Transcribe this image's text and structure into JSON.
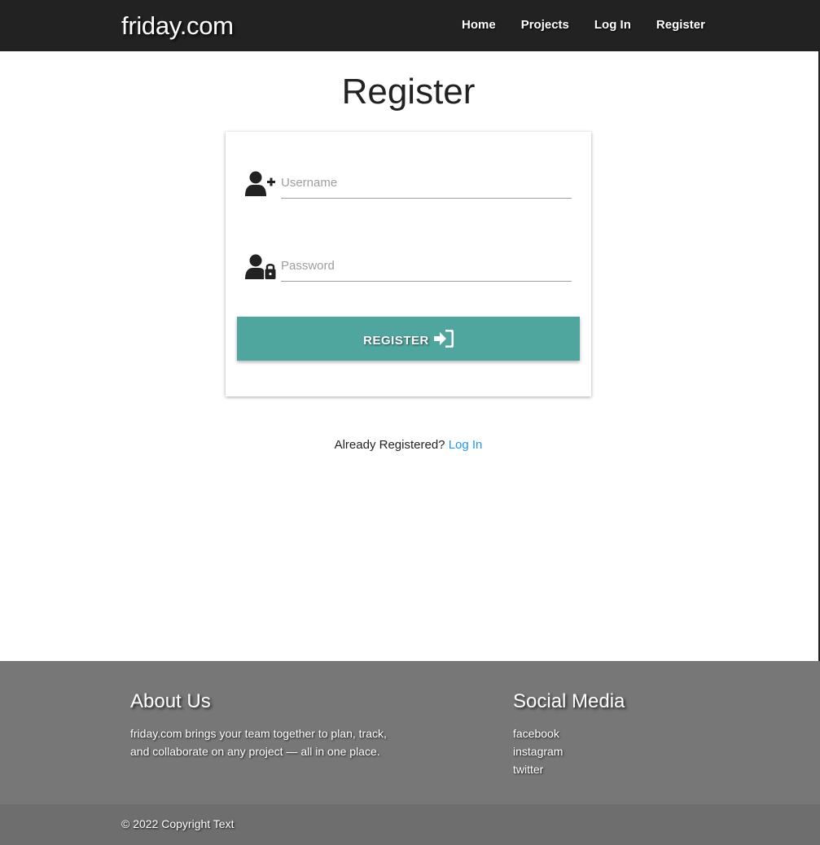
{
  "navbar": {
    "brand": "friday.com",
    "links": [
      {
        "label": "Home"
      },
      {
        "label": "Projects"
      },
      {
        "label": "Log In"
      },
      {
        "label": "Register"
      }
    ]
  },
  "page": {
    "title": "Register"
  },
  "form": {
    "username": {
      "placeholder": "Username",
      "value": "",
      "icon": "user-plus-icon"
    },
    "password": {
      "placeholder": "Password",
      "value": "",
      "icon": "user-lock-icon"
    },
    "submit": {
      "label": "REGISTER",
      "icon": "sign-in-icon"
    }
  },
  "login_prompt": {
    "text": "Already Registered?",
    "link_label": "Log In"
  },
  "footer": {
    "about_title": "About Us",
    "about_text": "friday.com brings your team together to plan, track, and collaborate on any project — all in one place.",
    "social_title": "Social Media",
    "social_links": [
      "facebook",
      "instagram",
      "twitter"
    ],
    "copyright": "© 2022 Copyright Text"
  },
  "colors": {
    "navbar": "#222222",
    "accent": "#4fa69e",
    "link": "#2196f3",
    "footer": "#777777",
    "footer_bottom": "#6e6e6e"
  }
}
